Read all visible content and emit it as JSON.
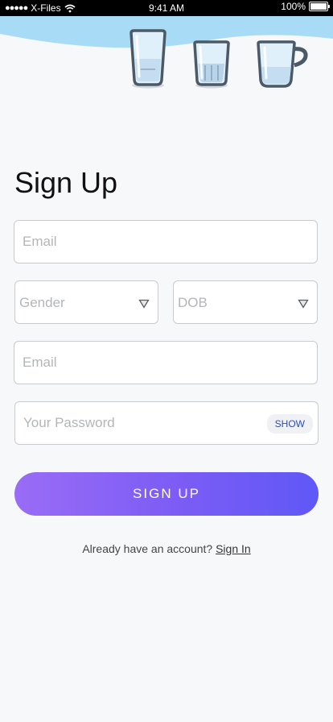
{
  "status_bar": {
    "carrier": "X-Files",
    "time": "9:41 AM",
    "battery": "100%"
  },
  "title": "Sign Up",
  "form": {
    "email_placeholder": "Email",
    "gender_label": "Gender",
    "dob_label": "DOB",
    "email2_placeholder": "Email",
    "password_placeholder": "Your Password",
    "show_label": "SHOW"
  },
  "signup_button": "SIGN UP",
  "footer": {
    "prompt": "Already have an account?",
    "signin_link": "Sign In"
  },
  "colors": {
    "header_wave": "#a8dcf6",
    "button_start": "#9a6cf6",
    "button_end": "#5f58f7",
    "cup_outline": "#4b5a66",
    "show_text": "#2a4fb8"
  }
}
